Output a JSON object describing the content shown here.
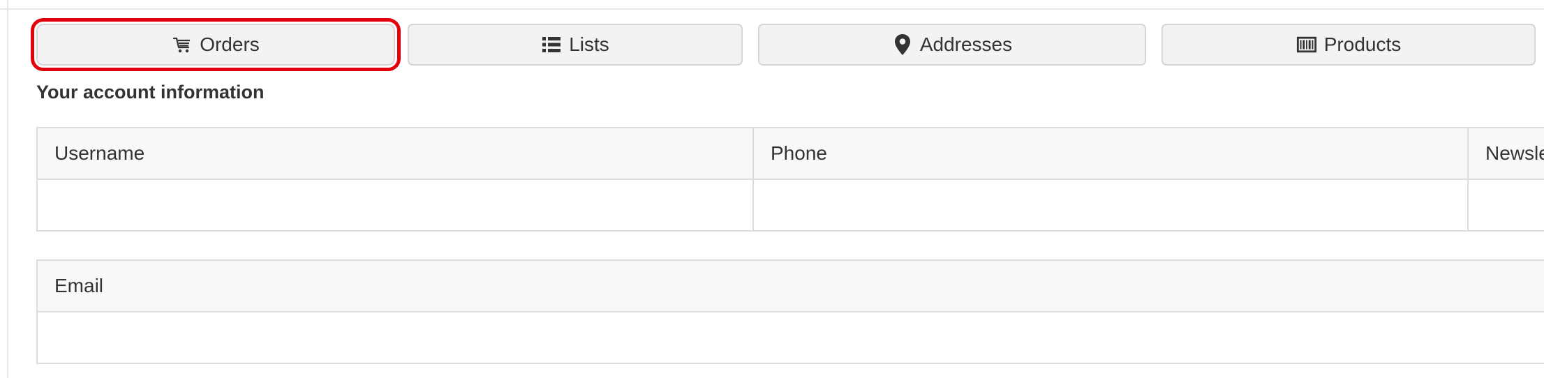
{
  "tabs": [
    {
      "label": "Orders",
      "icon": "cart-icon",
      "highlighted": true
    },
    {
      "label": "Lists",
      "icon": "list-icon",
      "highlighted": false
    },
    {
      "label": "Addresses",
      "icon": "map-marker-icon",
      "highlighted": false
    },
    {
      "label": "Products",
      "icon": "barcode-icon",
      "highlighted": false
    }
  ],
  "account": {
    "title": "Your account information",
    "columns": [
      "Username",
      "Phone",
      "Newsle"
    ],
    "row": [
      "",
      "",
      ""
    ],
    "email_column": "Email",
    "email_value": ""
  },
  "colors": {
    "highlight": "#e3000b",
    "tab_background": "#f3f3f3",
    "header_background": "#f8f8f8",
    "border": "#dddddd"
  }
}
